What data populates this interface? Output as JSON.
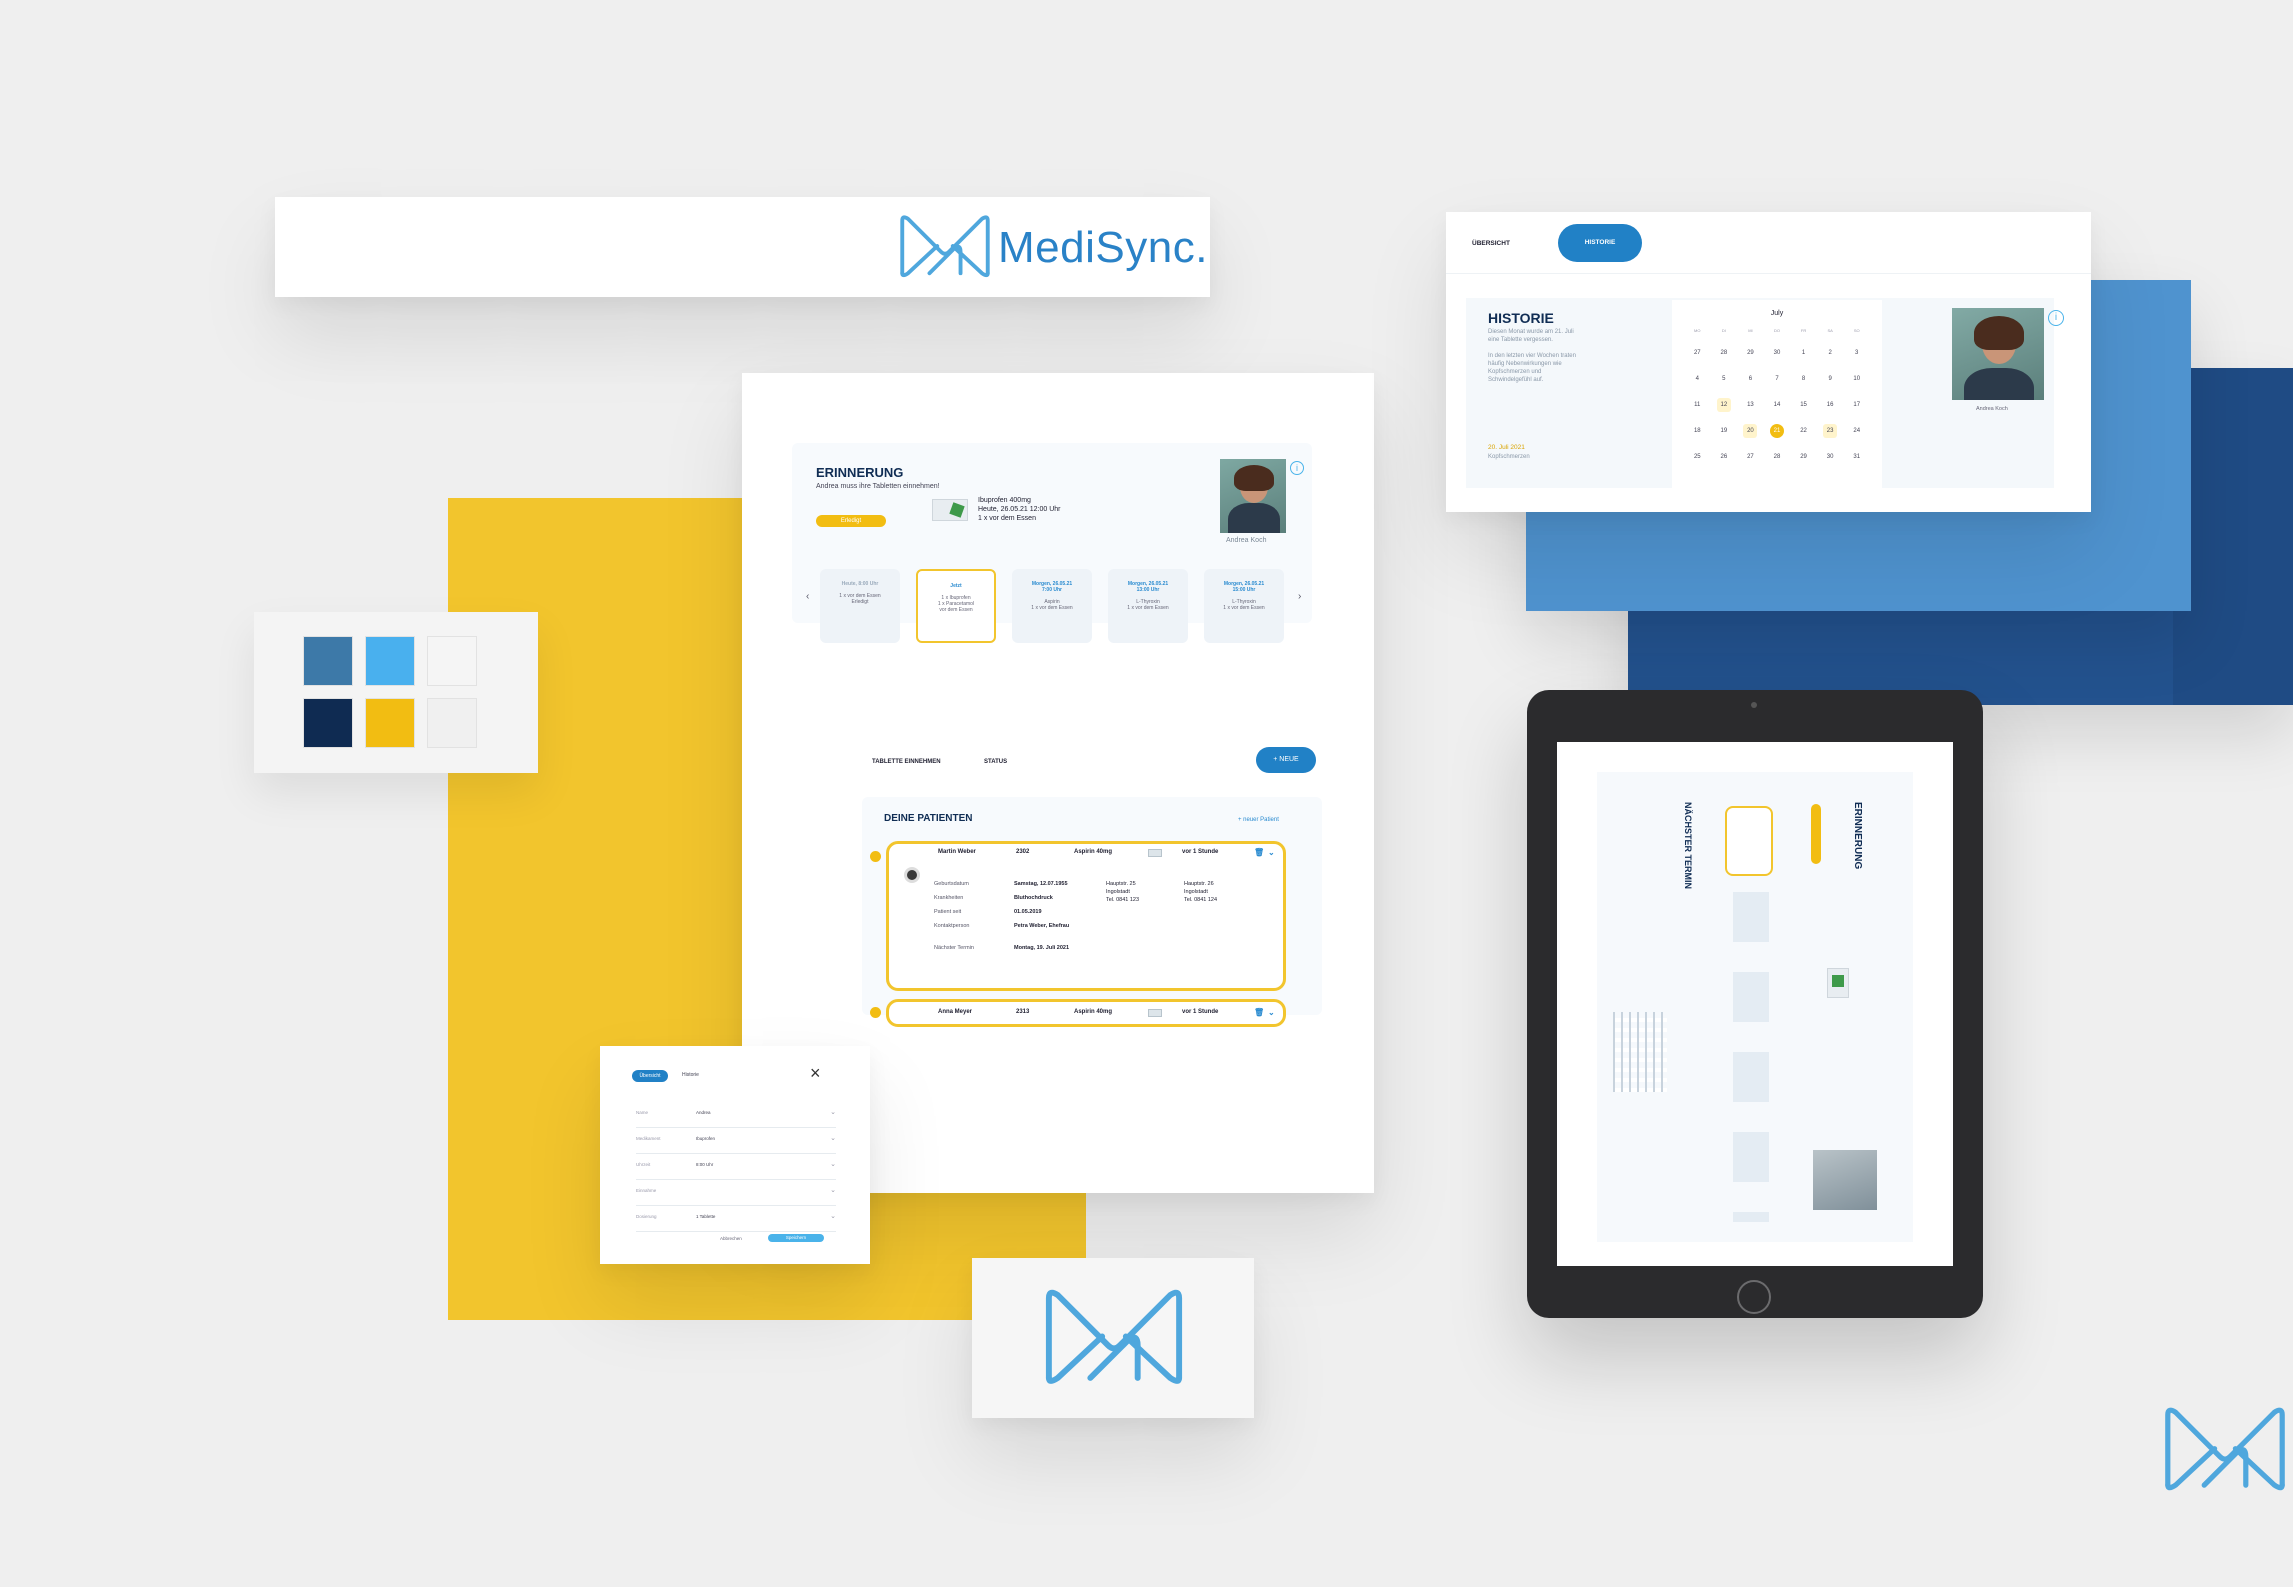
{
  "brand": {
    "name": "MediSync."
  },
  "colors": {
    "background": "#efefef",
    "yellow": "#f2c52d",
    "blue_mid": "#4f93cf",
    "blue_navy": "#23528e",
    "primary": "#2181c6",
    "dark": "#0f2b52",
    "light_blue": "#4ab3ea"
  },
  "palette": [
    {
      "color": "#3d79a8"
    },
    {
      "color": "#49b0ee"
    },
    {
      "color": "#f5f5f5"
    },
    {
      "color": "#0f2b52"
    },
    {
      "color": "#f2bd12"
    },
    {
      "color": "#f0f0f0"
    }
  ],
  "reminder_panel": {
    "title": "ERINNERUNG",
    "subtitle": "Andrea muss ihre Tabletten einnehmen!",
    "action_label": "Erledigt",
    "med_name": "Ibuprofen 400mg",
    "med_time": "Heute, 26.05.21 12:00 Uhr",
    "med_note": "1 x vor dem Essen",
    "patient_name": "Andrea Koch",
    "slots": [
      {
        "title": "Heute, 8:00 Uhr",
        "line1": "1 x vor dem Essen",
        "line2": "Erledigt"
      },
      {
        "title": "Jetzt",
        "line1": "1 x Ibuprofen",
        "line2": "1 x Paracetamol",
        "line3": "vor dem Essen"
      },
      {
        "title": "Morgen, 26.05.21",
        "sub": "7:00 Uhr",
        "line1": "Aspirin",
        "line2": "1 x vor dem Essen"
      },
      {
        "title": "Morgen, 26.05.21",
        "sub": "13:00 Uhr",
        "line1": "L-Thyroxin",
        "line2": "1 x vor dem Essen"
      },
      {
        "title": "Morgen, 26.05.21",
        "sub": "15:00 Uhr",
        "line1": "L-Thyroxin",
        "line2": "1 x vor dem Essen"
      }
    ],
    "toolbar": {
      "filter1": "TABLETTE EINNEHMEN",
      "filter2": "STATUS",
      "new_label": "+ NEUE"
    },
    "patients_title": "DEINE PATIENTEN",
    "patients_link": "+ neuer Patient",
    "patients": [
      {
        "name": "Martin Weber",
        "room": "2302",
        "med": "Aspirin 40mg",
        "time": "vor 1 Stunde",
        "details": [
          [
            "Geburtsdatum",
            "Samstag, 12.07.1955"
          ],
          [
            "Krankheiten",
            "Bluthochdruck"
          ],
          [
            "Patient seit",
            "01.05.2019"
          ],
          [
            "Kontaktperson",
            "Petra Weber, Ehefrau"
          ],
          [
            "Nächster Termin",
            "Montag, 19. Juli 2021"
          ]
        ],
        "contact1": [
          "Hauptstr. 25",
          "Ingolstadt",
          "Tel. 0841 123"
        ],
        "contact2": [
          "Hauptstr. 26",
          "Ingolstadt",
          "Tel. 0841 124"
        ]
      },
      {
        "name": "Anna Meyer",
        "room": "2313",
        "med": "Aspirin 40mg",
        "time": "vor 1 Stunde"
      }
    ]
  },
  "history_panel": {
    "tab_overview": "ÜBERSICHT",
    "tab_history": "HISTORIE",
    "title": "HISTORIE",
    "text1": "Diesen Monat wurde am 21. Juli eine Tablette vergessen.",
    "text2": "In den letzten vier Wochen traten häufig Nebenwirkungen wie Kopfschmerzen und Schwindelgefühl auf.",
    "date": "20. Juli 2021",
    "date_note": "Kopfschmerzen",
    "month": "July",
    "weekdays": [
      "MO",
      "DI",
      "MI",
      "DO",
      "FR",
      "SA",
      "SO"
    ],
    "weeks": [
      [
        "27",
        "28",
        "29",
        "30",
        "1",
        "2",
        "3"
      ],
      [
        "4",
        "5",
        "6",
        "7",
        "8",
        "9",
        "10"
      ],
      [
        "11",
        "12",
        "13",
        "14",
        "15",
        "16",
        "17"
      ],
      [
        "18",
        "19",
        "20",
        "21",
        "22",
        "23",
        "24"
      ],
      [
        "25",
        "26",
        "27",
        "28",
        "29",
        "30",
        "31"
      ]
    ],
    "patient_name": "Andrea Koch"
  },
  "modal": {
    "tab1": "Übersicht",
    "tab2": "Historie",
    "rows": [
      [
        "Name",
        "Andrea"
      ],
      [
        "Medikament",
        "Ibuprofen"
      ],
      [
        "Uhrzeit",
        "8:00 Uhr"
      ],
      [
        "Einnahme",
        ""
      ],
      [
        "Dosierung",
        "1 Tablette"
      ]
    ],
    "cancel": "Abbrechen",
    "save": "Speichern"
  },
  "tablet": {
    "title": "ERINNERUNG",
    "sub_title": "NÄCHSTER TERMIN"
  }
}
